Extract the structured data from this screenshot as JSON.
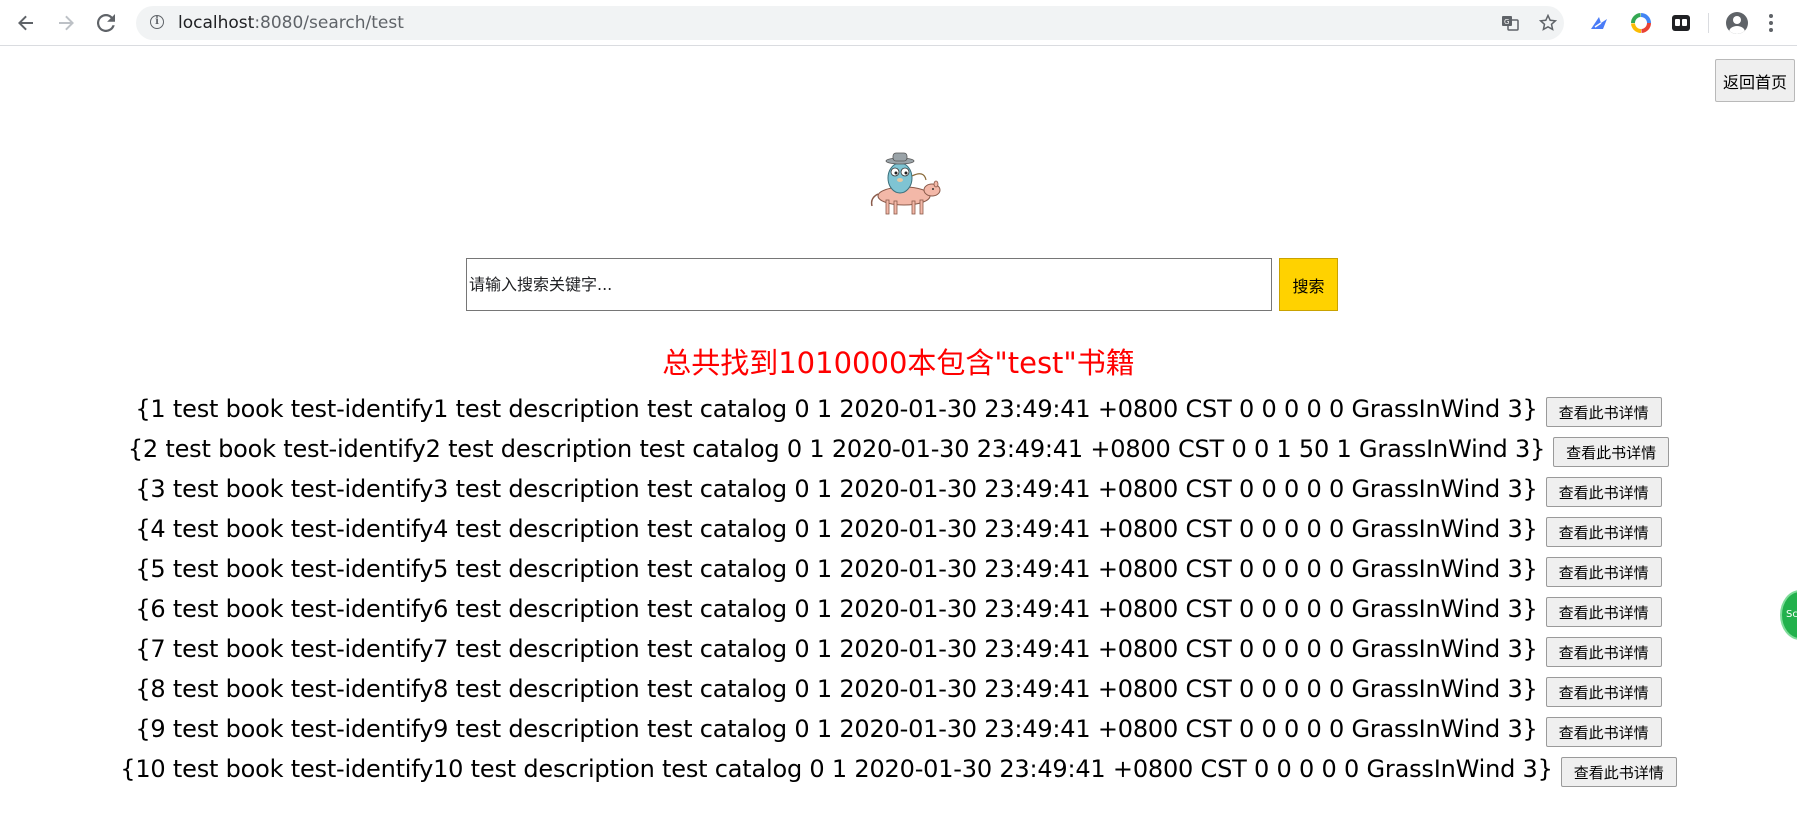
{
  "browser": {
    "url_host": "localhost",
    "url_rest": ":8080/search/test",
    "icons": {
      "back": "arrow-left-icon",
      "forward": "arrow-right-icon",
      "reload": "reload-icon",
      "info": "info-icon",
      "translate": "translate-icon",
      "bookmark": "star-icon",
      "menu": "more-vert-icon"
    }
  },
  "page": {
    "home_button": "返回首页",
    "search": {
      "placeholder": "请输入搜索关键字...",
      "button": "搜索"
    },
    "result_summary": "总共找到1010000本包含\"test\"书籍",
    "detail_button_label": "查看此书详情",
    "books": [
      "{1 test book test-identify1 test description test catalog 0 1 2020-01-30 23:49:41 +0800 CST 0 0 0 0 0 GrassInWind 3}",
      "{2 test book test-identify2 test description test catalog 0 1 2020-01-30 23:49:41 +0800 CST 0 0 1 50 1 GrassInWind 3}",
      "{3 test book test-identify3 test description test catalog 0 1 2020-01-30 23:49:41 +0800 CST 0 0 0 0 0 GrassInWind 3}",
      "{4 test book test-identify4 test description test catalog 0 1 2020-01-30 23:49:41 +0800 CST 0 0 0 0 0 GrassInWind 3}",
      "{5 test book test-identify5 test description test catalog 0 1 2020-01-30 23:49:41 +0800 CST 0 0 0 0 0 GrassInWind 3}",
      "{6 test book test-identify6 test description test catalog 0 1 2020-01-30 23:49:41 +0800 CST 0 0 0 0 0 GrassInWind 3}",
      "{7 test book test-identify7 test description test catalog 0 1 2020-01-30 23:49:41 +0800 CST 0 0 0 0 0 GrassInWind 3}",
      "{8 test book test-identify8 test description test catalog 0 1 2020-01-30 23:49:41 +0800 CST 0 0 0 0 0 GrassInWind 3}",
      "{9 test book test-identify9 test description test catalog 0 1 2020-01-30 23:49:41 +0800 CST 0 0 0 0 0 GrassInWind 3}",
      "{10 test book test-identify10 test description test catalog 0 1 2020-01-30 23:49:41 +0800 CST 0 0 0 0 0 GrassInWind 3}"
    ],
    "side_float_label": "Sc"
  },
  "colors": {
    "result_summary": "#ff0000",
    "search_button": "#ffd200"
  }
}
